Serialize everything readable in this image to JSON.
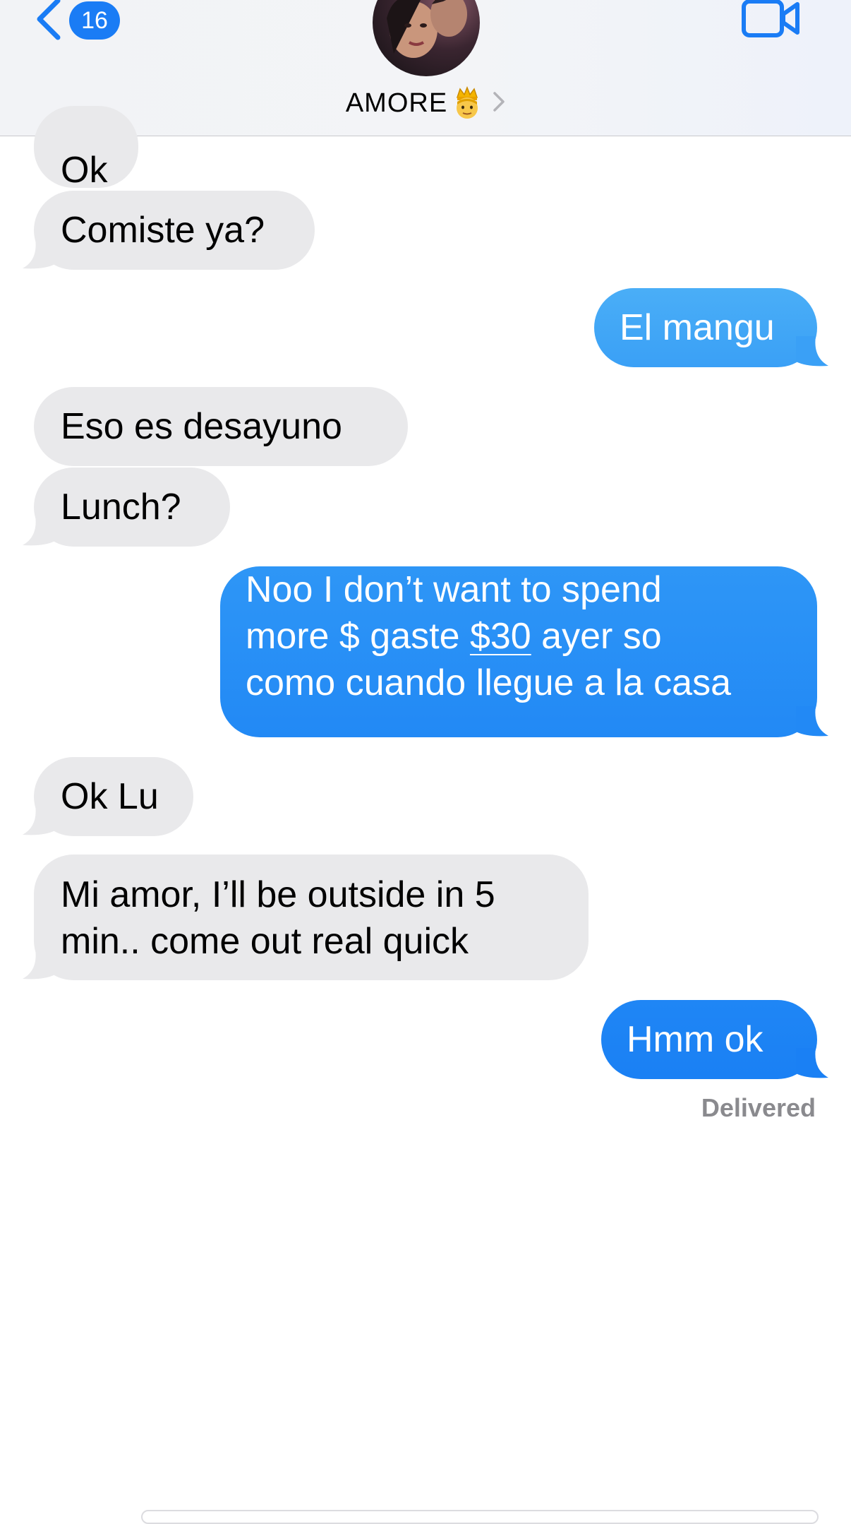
{
  "header": {
    "back_badge_count": "16",
    "contact_name": "AMORE",
    "back_icon": "chevron-left-icon",
    "video_icon": "video-camera-icon",
    "disclosure_icon": "chevron-right-icon",
    "avatar_icon": "contact-photo",
    "accent_color": "#1a7cf5"
  },
  "messages": [
    {
      "direction": "incoming",
      "text": "Ok"
    },
    {
      "direction": "incoming",
      "text": "Comiste ya?"
    },
    {
      "direction": "outgoing",
      "text": "El mangu"
    },
    {
      "direction": "incoming",
      "text": "Eso es desayuno"
    },
    {
      "direction": "incoming",
      "text": "Lunch?"
    },
    {
      "direction": "outgoing",
      "lines": [
        "Noo I don’t want to spend",
        "more $ gaste ",
        "$30",
        " ayer so",
        "como cuando llegue a la casa"
      ]
    },
    {
      "direction": "incoming",
      "text": "Ok Lu"
    },
    {
      "direction": "incoming",
      "lines": [
        "Mi amor, I’ll be outside in 5",
        "min.. come out real quick"
      ]
    },
    {
      "direction": "outgoing",
      "text": "Hmm ok"
    }
  ],
  "status": {
    "delivered": "Delivered"
  },
  "colors": {
    "incoming_bubble": "#e9e9eb",
    "outgoing_gradient_top": "#4aaef7",
    "outgoing_gradient_bottom": "#1f86f5"
  }
}
